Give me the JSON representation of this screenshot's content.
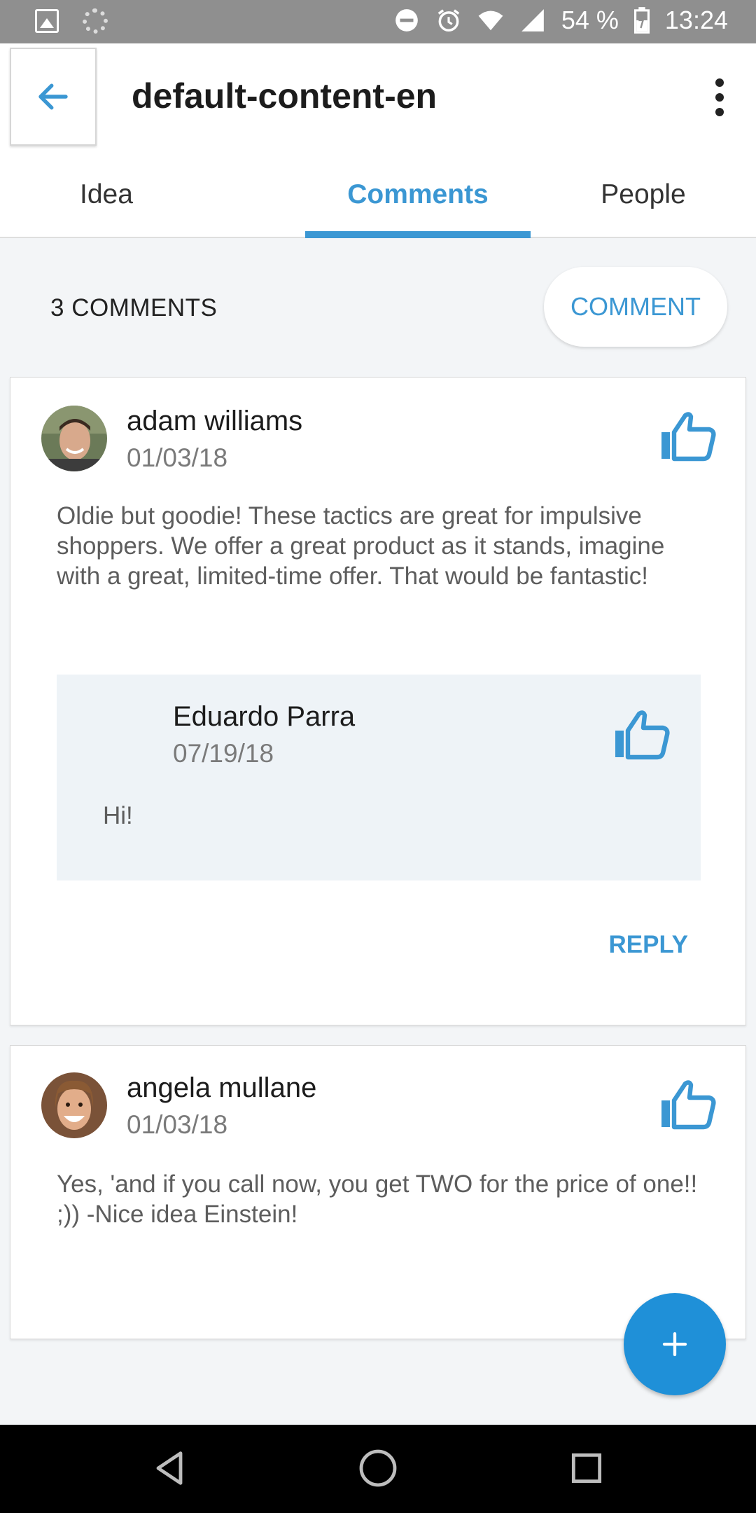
{
  "status_bar": {
    "battery": "54 %",
    "time": "13:24"
  },
  "app_bar": {
    "title": "default-content-en"
  },
  "tabs": [
    {
      "label": "Idea"
    },
    {
      "label": "Comments"
    },
    {
      "label": "People"
    }
  ],
  "comments_header": {
    "count_label": "3 COMMENTS",
    "comment_button": "COMMENT"
  },
  "comments": [
    {
      "author": "adam williams",
      "date": "01/03/18",
      "text": "Oldie but goodie! These tactics are great for impulsive shoppers. We offer a great product as it stands, imagine with a great, limited-time offer. That would be fantastic!",
      "replies": [
        {
          "author": "Eduardo Parra",
          "date": "07/19/18",
          "text": "Hi!"
        }
      ],
      "reply_label": "REPLY"
    },
    {
      "author": "angela mullane",
      "date": "01/03/18",
      "text": "Yes, 'and if you call now, you get TWO for the price of one!! ;)) -Nice idea Einstein!"
    }
  ],
  "colors": {
    "accent": "#3b97d3",
    "fab": "#1f90d8"
  }
}
